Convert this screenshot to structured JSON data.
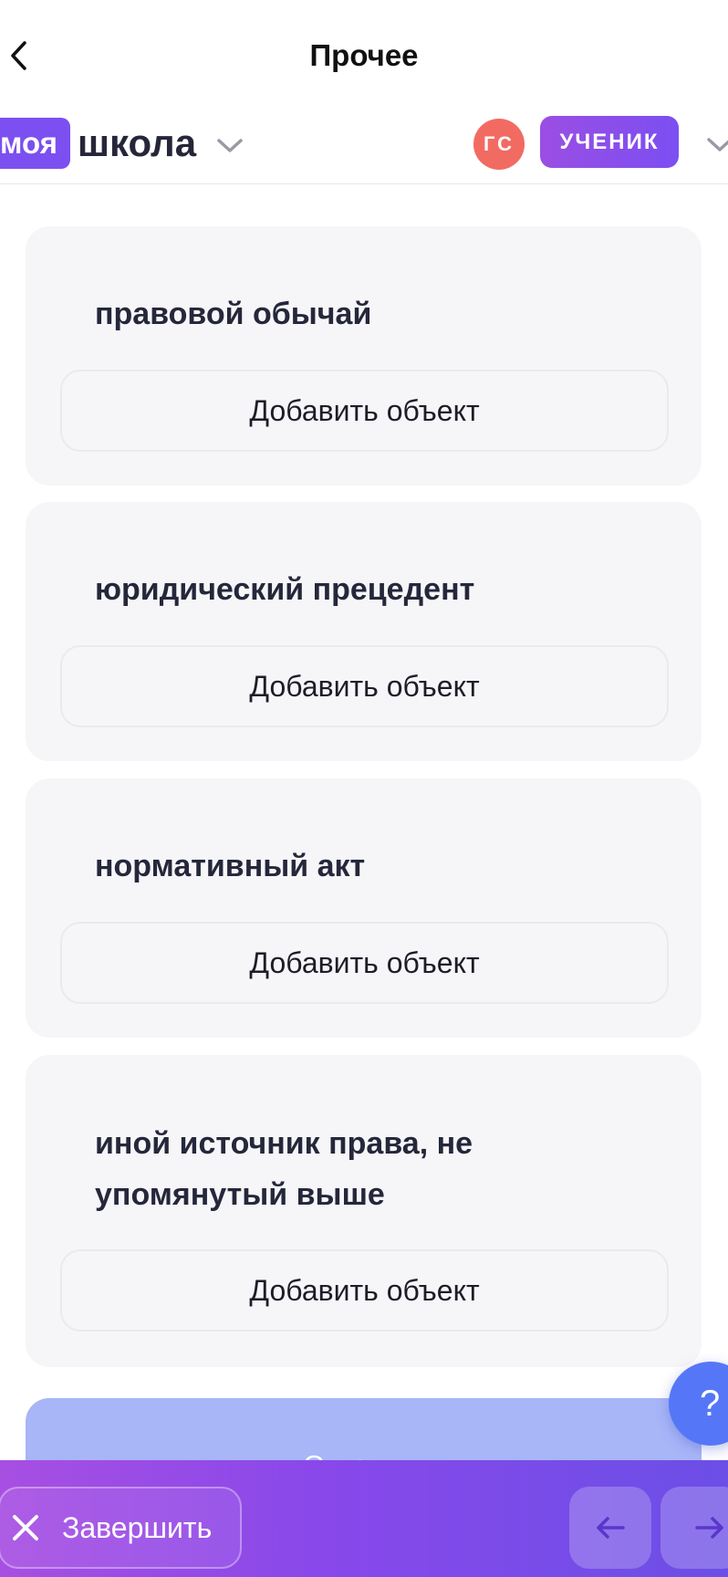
{
  "header": {
    "title": "Прочее",
    "back_icon": "chevron-left-icon"
  },
  "brand": {
    "logo_pill": "моя",
    "logo_word": "школа",
    "logo_chevron_icon": "chevron-down-icon",
    "avatar_initials": "ГС",
    "role": "УЧЕНИК",
    "role_chevron_icon": "chevron-down-icon",
    "accent_color": "#7c4ff0",
    "avatar_color": "#f26b62"
  },
  "categories": [
    {
      "title": "правовой обычай",
      "button_label": "Добавить объект"
    },
    {
      "title": "юридический прецедент",
      "button_label": "Добавить объект"
    },
    {
      "title": "нормативный акт",
      "button_label": "Добавить объект"
    },
    {
      "title": "иной источник права, не упомянутый выше",
      "button_label": "Добавить объект"
    }
  ],
  "submit": {
    "label": "Ответить",
    "state": "disabled",
    "color": "#a8b5f7"
  },
  "help": {
    "label": "?",
    "icon": "question-icon"
  },
  "footer": {
    "finish_label": "Завершить",
    "finish_icon": "close-icon",
    "prev_icon": "arrow-left-icon",
    "next_icon": "arrow-right-icon"
  }
}
